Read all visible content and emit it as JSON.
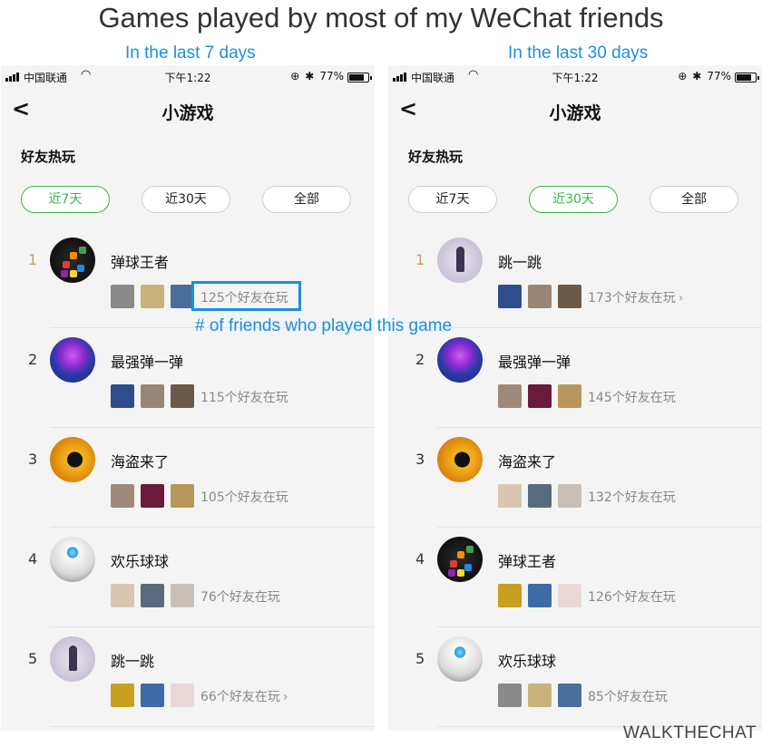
{
  "header": {
    "title": "Games played by most of my WeChat friends",
    "left_caption": "In the last 7 days",
    "right_caption": "In the last 30 days",
    "annotation": "# of friends who played this game",
    "watermark": "WALKTHECHAT"
  },
  "status_bar": {
    "carrier": "中国联通",
    "time": "下午1:22",
    "battery": "77%"
  },
  "nav": {
    "back_icon": "chevron-left-icon",
    "title": "小游戏"
  },
  "section_title": "好友热玩",
  "tabs": [
    "近7天",
    "近30天",
    "全部"
  ],
  "colors": {
    "accent_green": "#3bb54a",
    "annotation_blue": "#1a8fe0",
    "rank_gold": "#c8a05a"
  },
  "left": {
    "active_tab": 0,
    "games": [
      {
        "rank": "1",
        "name": "弹球王者",
        "count": "125个好友在玩",
        "icon": "g-tanqiu",
        "arrow": false
      },
      {
        "rank": "2",
        "name": "最强弹一弹",
        "count": "115个好友在玩",
        "icon": "g-zuiqiang",
        "arrow": false
      },
      {
        "rank": "3",
        "name": "海盗来了",
        "count": "105个好友在玩",
        "icon": "g-haidao",
        "arrow": false
      },
      {
        "rank": "4",
        "name": "欢乐球球",
        "count": "76个好友在玩",
        "icon": "g-huanle",
        "arrow": false
      },
      {
        "rank": "5",
        "name": "跳一跳",
        "count": "66个好友在玩",
        "icon": "g-tiaoyitiao",
        "arrow": true
      }
    ]
  },
  "right": {
    "active_tab": 1,
    "games": [
      {
        "rank": "1",
        "name": "跳一跳",
        "count": "173个好友在玩",
        "icon": "g-tiaoyitiao",
        "arrow": true
      },
      {
        "rank": "2",
        "name": "最强弹一弹",
        "count": "145个好友在玩",
        "icon": "g-zuiqiang",
        "arrow": false
      },
      {
        "rank": "3",
        "name": "海盗来了",
        "count": "132个好友在玩",
        "icon": "g-haidao",
        "arrow": false
      },
      {
        "rank": "4",
        "name": "弹球王者",
        "count": "126个好友在玩",
        "icon": "g-tanqiu",
        "arrow": false
      },
      {
        "rank": "5",
        "name": "欢乐球球",
        "count": "85个好友在玩",
        "icon": "g-huanle",
        "arrow": false
      }
    ]
  }
}
